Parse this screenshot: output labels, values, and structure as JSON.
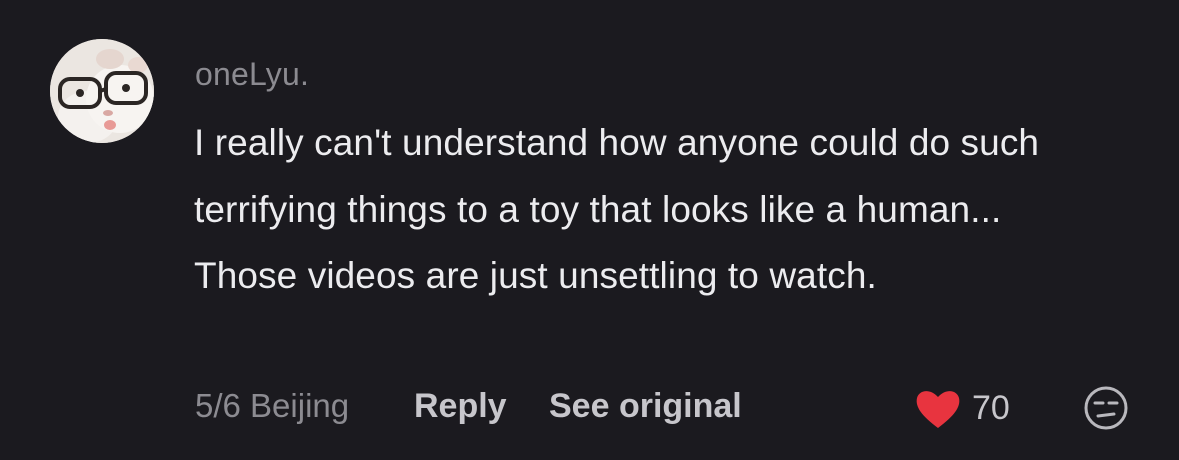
{
  "comment": {
    "username": "oneLyu.",
    "text": "I really can't understand how anyone could do such terrifying things to a toy that looks like a human... Those videos are just unsettling to watch.",
    "date_location": "5/6 Beijing",
    "reply_label": "Reply",
    "see_original_label": "See original",
    "like_count": "70",
    "avatar_icon": "hamster-with-glasses-avatar",
    "like_icon": "heart-icon",
    "like_color": "#e8343f",
    "reaction_icon": "unamused-face-icon"
  }
}
